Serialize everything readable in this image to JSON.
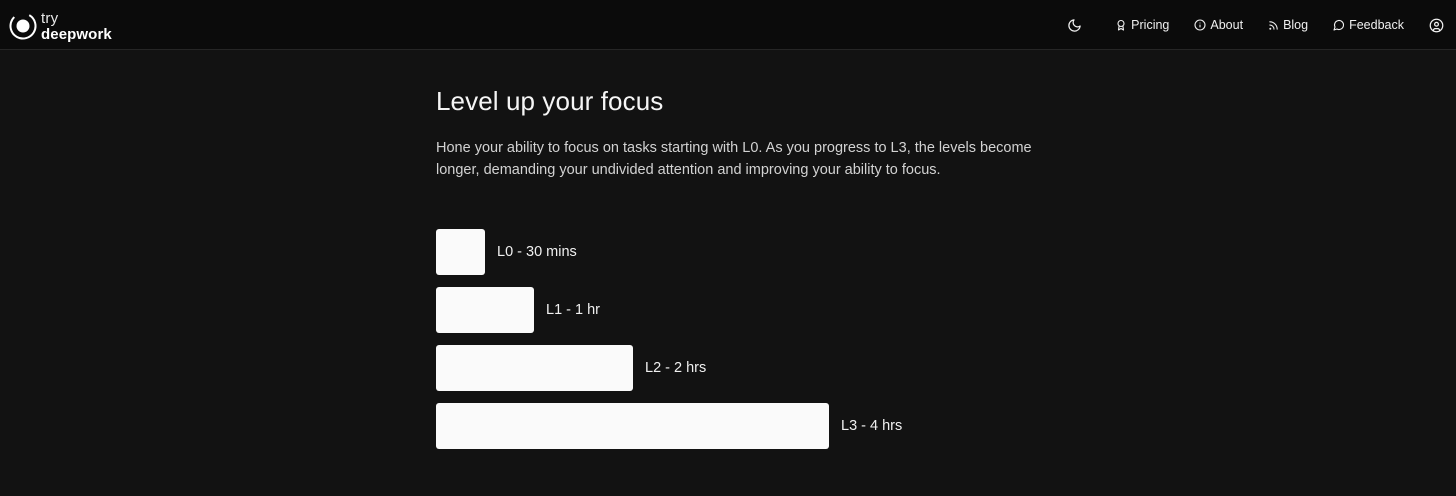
{
  "brand": {
    "line1": "try",
    "line2": "deepwork"
  },
  "nav": {
    "theme_icon": "moon-icon",
    "items": [
      {
        "label": "Pricing",
        "icon": "badge-icon"
      },
      {
        "label": "About",
        "icon": "info-icon"
      },
      {
        "label": "Blog",
        "icon": "rss-icon"
      },
      {
        "label": "Feedback",
        "icon": "chat-bubble-icon"
      }
    ],
    "account_icon": "user-circle-icon"
  },
  "main": {
    "title": "Level up your focus",
    "description": "Hone your ability to focus on tasks starting with L0. As you progress to L3, the levels become longer, demanding your undivided attention and improving your ability to focus.",
    "levels": [
      {
        "label": "L0 - 30 mins",
        "minutes": 30
      },
      {
        "label": "L1 - 1 hr",
        "minutes": 60
      },
      {
        "label": "L2 - 2 hrs",
        "minutes": 120
      },
      {
        "label": "L3 - 4 hrs",
        "minutes": 240
      }
    ]
  },
  "colors": {
    "background": "#121212",
    "topbar": "#0b0b0b",
    "bar": "#fafafa",
    "text": "#f2f2f2"
  }
}
